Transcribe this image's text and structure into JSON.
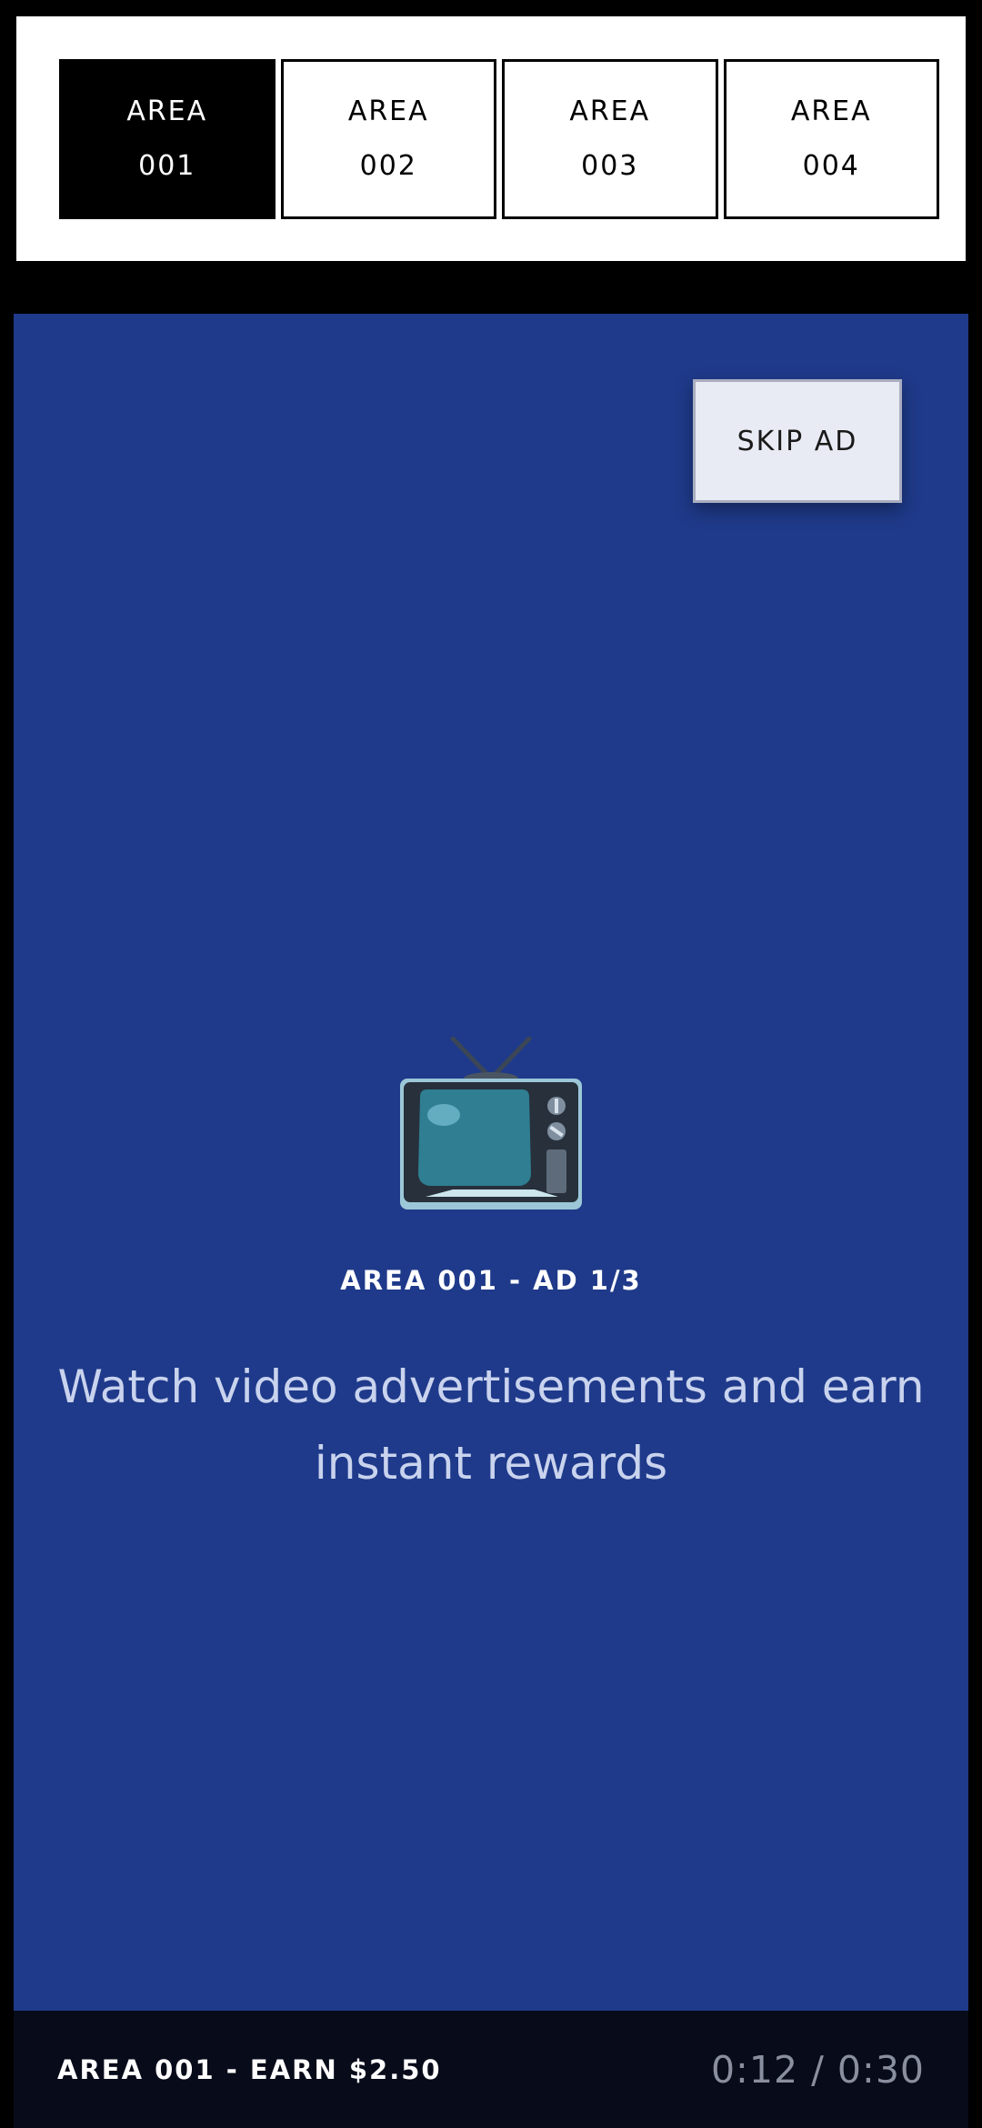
{
  "tabs": [
    {
      "line1": "AREA",
      "line2": "001",
      "active": true
    },
    {
      "line1": "AREA",
      "line2": "002",
      "active": false
    },
    {
      "line1": "AREA",
      "line2": "003",
      "active": false
    },
    {
      "line1": "AREA",
      "line2": "004",
      "active": false
    }
  ],
  "ad": {
    "skip_label": "SKIP AD",
    "icon": "tv-icon",
    "label": "AREA 001 - AD 1/3",
    "description": "Watch video advertisements and earn instant rewards"
  },
  "footer": {
    "earn_label": "AREA 001 - EARN $2.50",
    "time": "0:12 / 0:30"
  },
  "colors": {
    "ad_background": "#1f3a8a",
    "footer_background": "#080b1a",
    "tab_active_bg": "#000000",
    "tab_inactive_bg": "#ffffff",
    "skip_button_bg": "#e8eaf4"
  }
}
